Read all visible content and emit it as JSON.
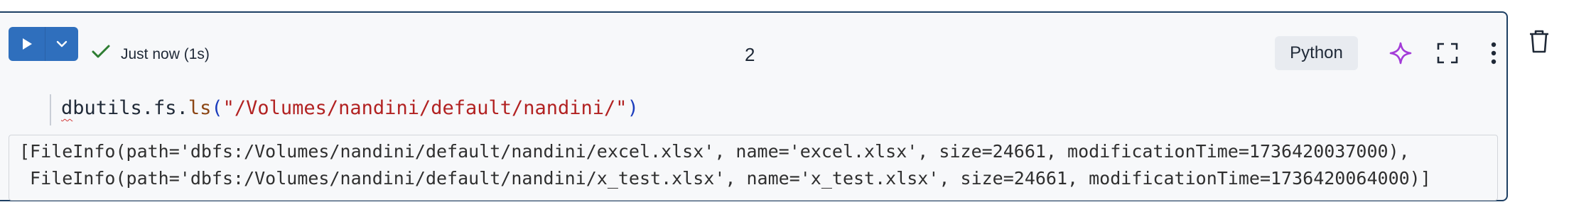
{
  "cell": {
    "status_text": "Just now (1s)",
    "execution_count": "2",
    "language": "Python",
    "code": {
      "obj": "dbutils.fs.",
      "first_char": "d",
      "rest": "butils.fs.",
      "fn": "ls",
      "open_paren": "(",
      "arg": "\"/Volumes/nandini/default/nandini/\"",
      "close_paren": ")"
    },
    "output_lines": [
      "[FileInfo(path='dbfs:/Volumes/nandini/default/nandini/excel.xlsx', name='excel.xlsx', size=24661, modificationTime=1736420037000),",
      " FileInfo(path='dbfs:/Volumes/nandini/default/nandini/x_test.xlsx', name='x_test.xlsx', size=24661, modificationTime=1736420064000)]"
    ]
  },
  "icons": {
    "run": "play-icon",
    "run_menu": "chevron-down-icon",
    "status": "check-icon",
    "assistant": "sparkle-icon",
    "fullscreen": "expand-icon",
    "more": "kebab-icon",
    "delete": "trash-icon"
  },
  "colors": {
    "run_button": "#2f6fbd",
    "cell_border": "#1d3f63",
    "success_check": "#2e7d32",
    "sparkle": "#a33bd8",
    "string": "#b22222",
    "function": "#8b4513"
  }
}
